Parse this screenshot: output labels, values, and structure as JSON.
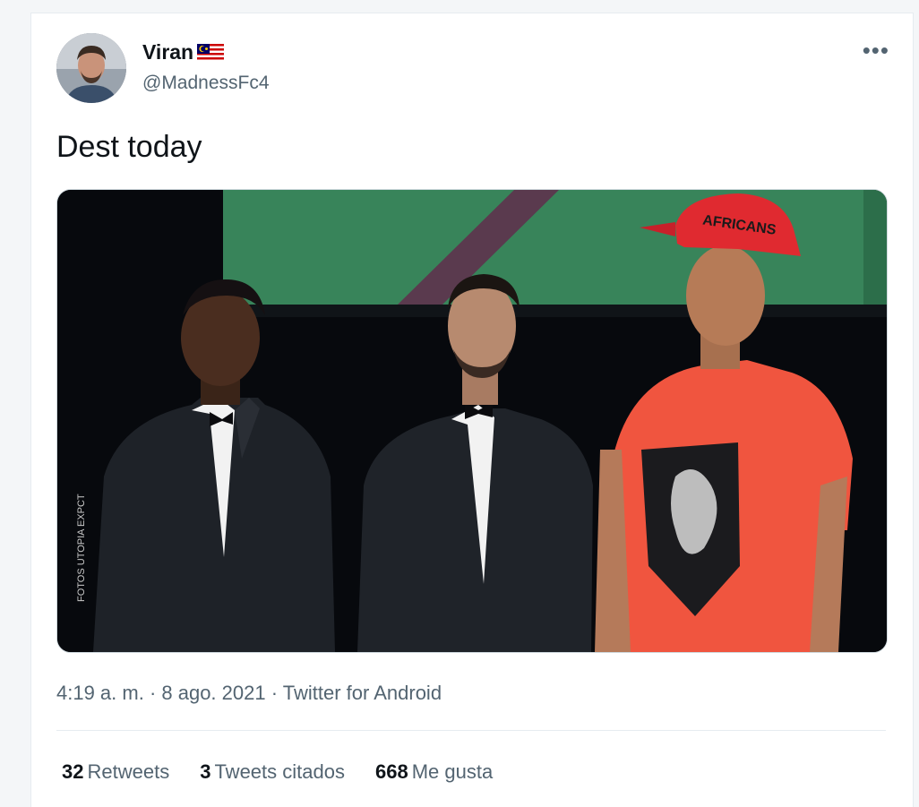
{
  "tweet": {
    "author": {
      "display_name": "Viran",
      "handle": "@MadnessFc4",
      "flag_icon": "malaysia-flag-icon"
    },
    "text": "Dest today",
    "media": {
      "watermark": "FOTOS UTOPIA EXPCT",
      "cap_text": "AFRICANS"
    },
    "meta": "4:19 a. m. · 8 ago. 2021 · Twitter for Android",
    "stats": [
      {
        "count": "32",
        "label": "Retweets"
      },
      {
        "count": "3",
        "label": "Tweets citados"
      },
      {
        "count": "668",
        "label": "Me gusta"
      }
    ]
  },
  "colors": {
    "text_primary": "#0f1419",
    "text_secondary": "#536471",
    "divider": "#e6ecf0",
    "shirt_red": "#f0553f",
    "cap_red": "#e02a30"
  }
}
